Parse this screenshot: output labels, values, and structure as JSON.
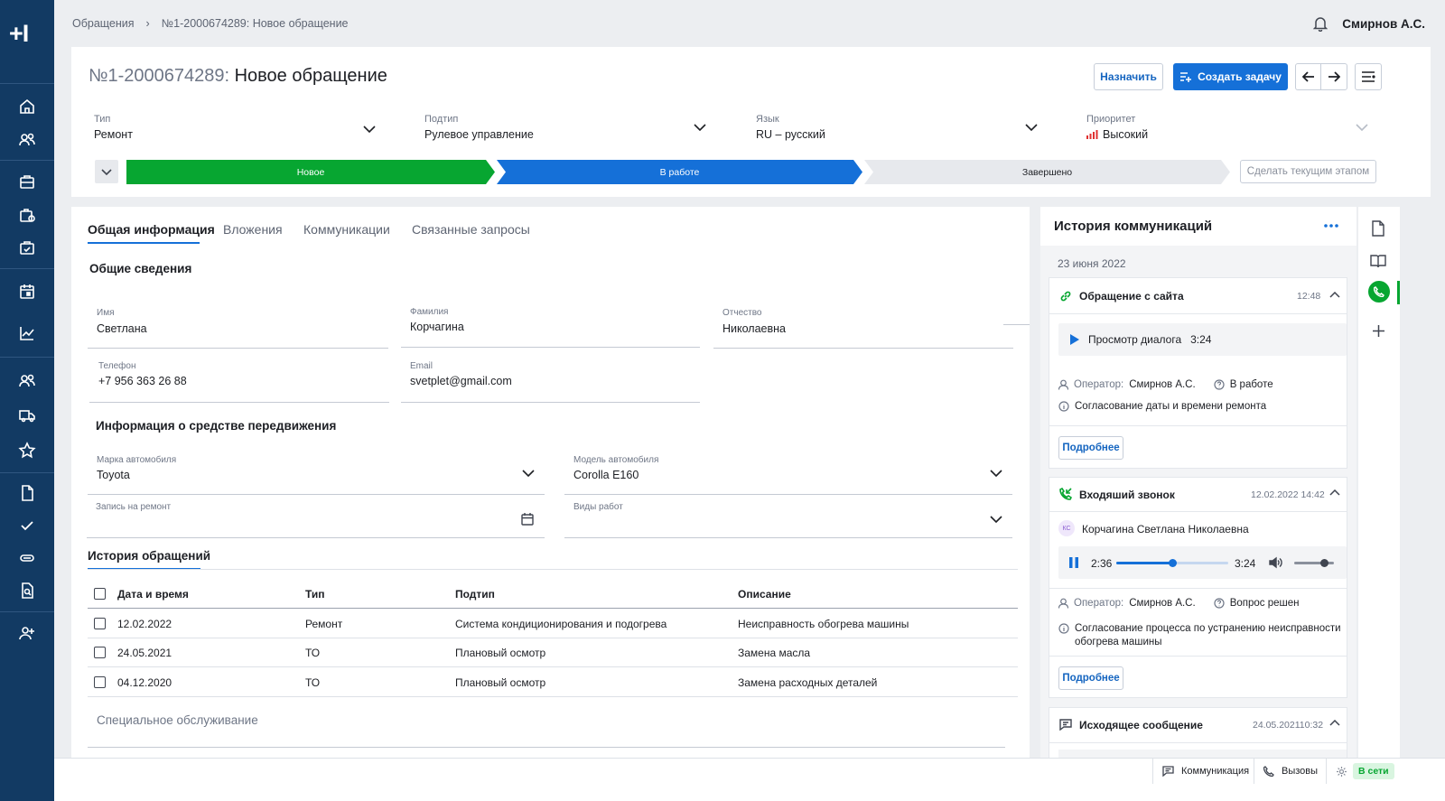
{
  "app": {
    "logo": "+I"
  },
  "breadcrumb": {
    "root": "Обращения",
    "current": "№1-2000674289: Новое обращение"
  },
  "user": {
    "name": "Смирнов А.С."
  },
  "ticket": {
    "number": "№1-2000674289:",
    "title": "Новое обращение",
    "actions": {
      "assign": "Назначить",
      "create_task": "Создать задачу"
    },
    "fields": [
      {
        "label": "Тип",
        "value": "Ремонт"
      },
      {
        "label": "Подтип",
        "value": "Рулевое управление"
      },
      {
        "label": "Язык",
        "value": "RU – русский"
      },
      {
        "label": "Приоритет",
        "value": "Высокий"
      }
    ],
    "stages": [
      {
        "label": "Новое",
        "status": "done",
        "color": "#07a631"
      },
      {
        "label": "В работе",
        "status": "current",
        "color": "#1570d8"
      },
      {
        "label": "Завершено",
        "status": "pending",
        "color": "#e7e9ed"
      }
    ],
    "make_current_stage": "Сделать текущим этапом"
  },
  "tabs": [
    "Общая информация",
    "Вложения",
    "Коммуникации",
    "Связанные запросы"
  ],
  "general": {
    "heading": "Общие сведения",
    "first_name": {
      "label": "Имя",
      "value": "Светлана"
    },
    "last_name": {
      "label": "Фамилия",
      "value": "Корчагина"
    },
    "patronymic": {
      "label": "Отчество",
      "value": "Николаевна"
    },
    "phone": {
      "label": "Телефон",
      "value": "+7 956 363 26 88"
    },
    "email": {
      "label": "Email",
      "value": "svetplet@gmail.com"
    }
  },
  "vehicle": {
    "heading": "Информация о средстве передвижения",
    "brand": {
      "label": "Марка автомобиля",
      "value": "Toyota"
    },
    "model": {
      "label": "Модель автомобиля",
      "value": "Corolla E160"
    },
    "repair_date": {
      "label": "Запись на ремонт",
      "value": ""
    },
    "work_types": {
      "label": "Виды работ",
      "value": ""
    }
  },
  "history": {
    "heading": "История обращений",
    "columns": [
      "Дата и время",
      "Тип",
      "Подтип",
      "Описание"
    ],
    "rows": [
      [
        "12.02.2022",
        "Ремонт",
        "Система кондиционирования и подогрева",
        "Неисправность обогрева машины"
      ],
      [
        "24.05.2021",
        "ТО",
        "Плановый осмотр",
        "Замена масла"
      ],
      [
        "04.12.2020",
        "ТО",
        "Плановый осмотр",
        "Замена расходных деталей"
      ]
    ],
    "special": "Специальное обслуживание"
  },
  "comm_history": {
    "title": "История коммуникаций",
    "date": "23 июня 2022",
    "cards": [
      {
        "title": "Обращение с сайта",
        "time": "12:48",
        "dialog": "Просмотр диалога",
        "duration": "3:24",
        "operator_label": "Оператор:",
        "operator": "Смирнов А.С.",
        "status": "В работе",
        "note": "Согласование даты и времени ремонта",
        "more": "Подробнее"
      },
      {
        "title": "Входяший звонок",
        "time": "12.02.2022 14:42",
        "initials": "КС",
        "contact": "Корчагина Светлана Николаевна",
        "elapsed": "2:36",
        "duration": "3:24",
        "progress": 0.5,
        "volume": 0.75,
        "operator_label": "Оператор:",
        "operator": "Смирнов А.С.",
        "status": "Вопрос решен",
        "note": "Согласование процесса по устранению неисправности обогрева машины",
        "more": "Подробнее"
      },
      {
        "title": "Исходящее сообщение",
        "time": "24.05.202110:32"
      }
    ]
  },
  "bottom_bar": {
    "communication": "Коммуникация",
    "calls": "Вызовы",
    "status": "В сети"
  }
}
